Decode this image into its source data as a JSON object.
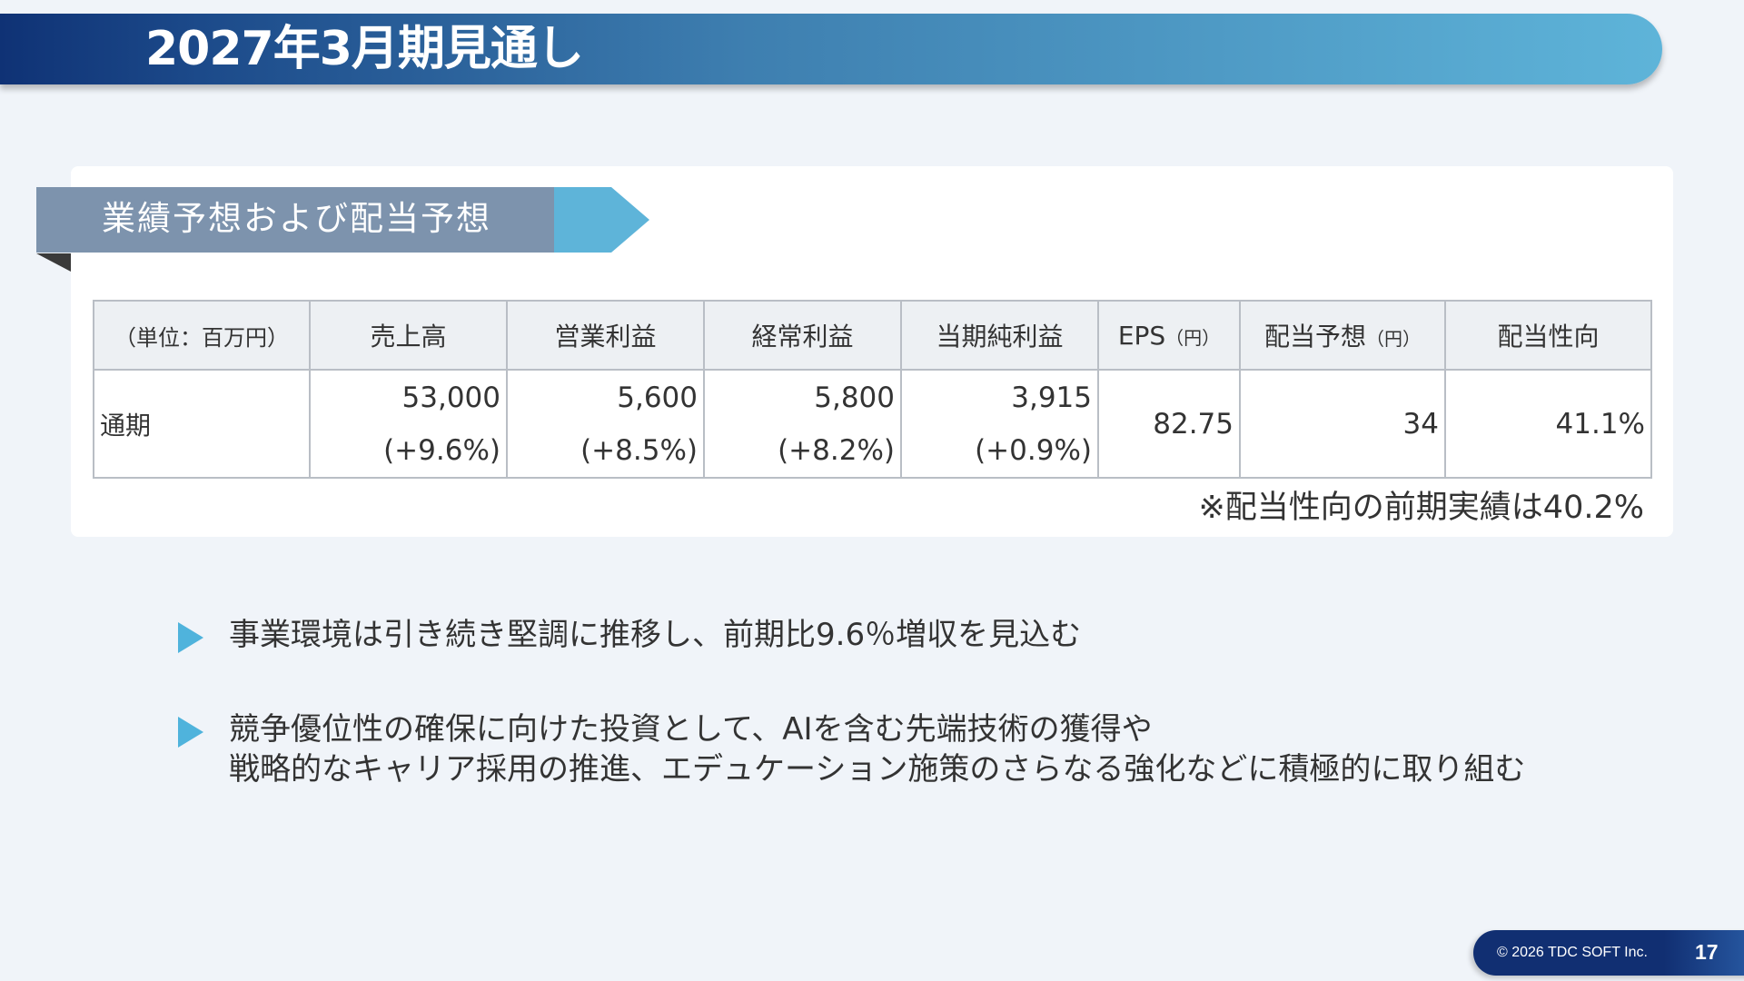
{
  "slide": {
    "title": "2027年3月期見通し",
    "section_label": "業績予想および配当予想",
    "page_number": "17",
    "copyright": "© 2026 TDC SOFT Inc."
  },
  "table": {
    "headers": [
      "（単位：百万円）",
      "売上高",
      "営業利益",
      "経常利益",
      "当期純利益"
    ],
    "eps_header": "EPS",
    "eps_unit": "（円）",
    "dividend_header": "配当予想",
    "dividend_unit": "（円）",
    "payout_header": "配当性向",
    "row_label": "通期",
    "values": {
      "sales": "53,000",
      "sales_change": "(+9.6%)",
      "operating_profit": "5,600",
      "operating_profit_change": "(+8.5%)",
      "ordinary_profit": "5,800",
      "ordinary_profit_change": "(+8.2%)",
      "net_income": "3,915",
      "net_income_change": "(+0.9%)",
      "eps": "82.75",
      "dividend": "34",
      "payout_ratio": "41.1%"
    },
    "note": "※配当性向の前期実績は40.2%"
  },
  "bullets": [
    {
      "lines": [
        "事業環境は引き続き堅調に推移し、前期比9.6％増収を見込む"
      ]
    },
    {
      "lines": [
        "競争優位性の確保に向けた投資として、AIを含む先端技術の獲得や",
        "戦略的なキャリア採用の推進、エデュケーション施策のさらなる強化などに積極的に取り組む"
      ]
    }
  ]
}
